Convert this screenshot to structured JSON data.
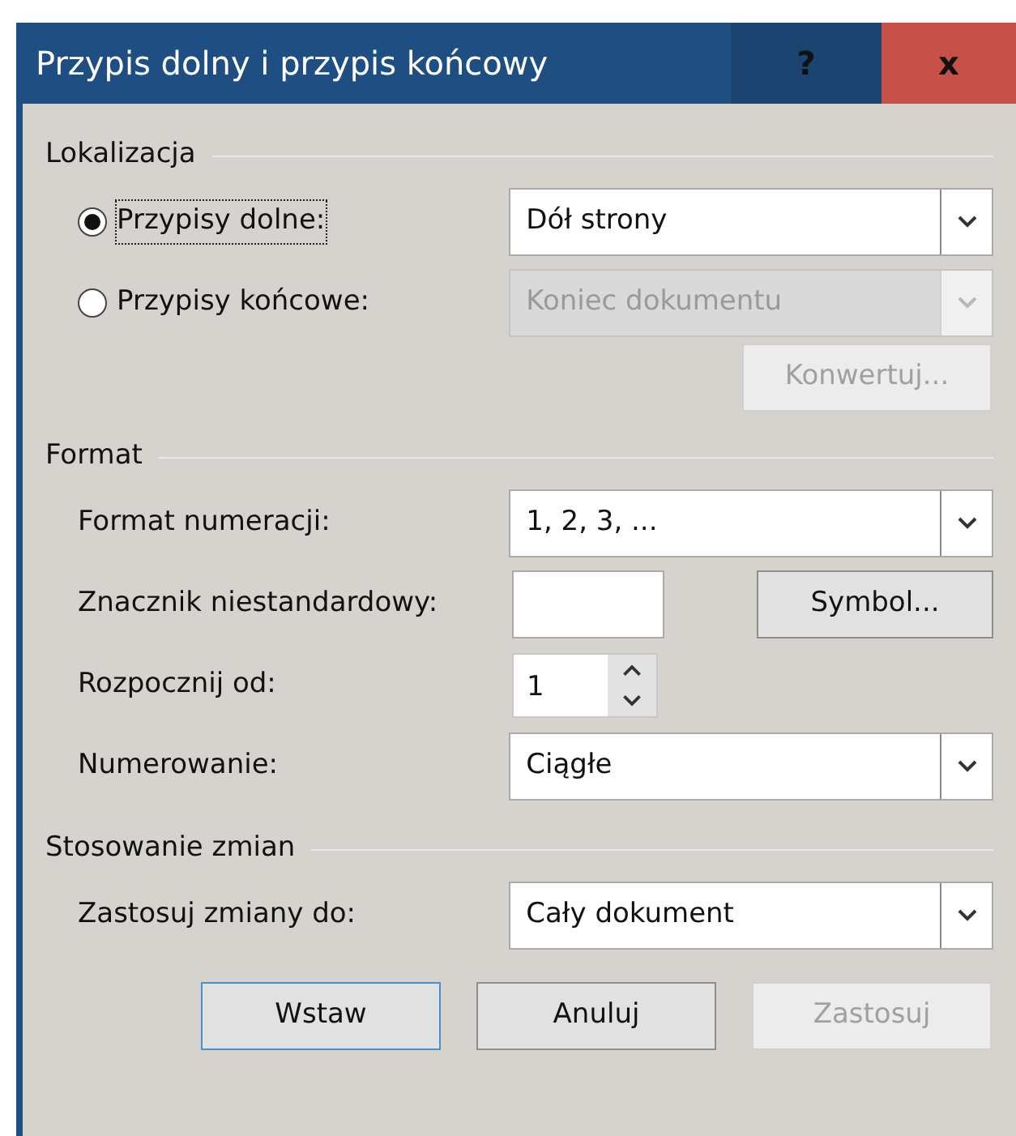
{
  "window": {
    "title": "Przypis dolny i przypis końcowy",
    "help_button": "?",
    "close_button": "x"
  },
  "sections": [
    {
      "title": "Lokalizacja",
      "rows": [
        {
          "kind": "radio",
          "label": "Przypisy dolne:",
          "selected": true,
          "focused": true,
          "control": {
            "kind": "dropdown",
            "value": "Dół strony",
            "disabled": false
          }
        },
        {
          "kind": "radio",
          "label": "Przypisy końcowe:",
          "selected": false,
          "focused": false,
          "control": {
            "kind": "dropdown",
            "value": "Koniec dokumentu",
            "disabled": true
          }
        },
        {
          "kind": "button",
          "button": {
            "label": "Konwertuj...",
            "disabled": true
          }
        }
      ]
    },
    {
      "title": "Format",
      "rows": [
        {
          "kind": "field",
          "label": "Format numeracji:",
          "control": {
            "kind": "dropdown",
            "value": "1, 2, 3, ...",
            "disabled": false
          }
        },
        {
          "kind": "field",
          "label": "Znacznik niestandardowy:",
          "control": {
            "kind": "text"
          },
          "button": {
            "label": "Symbol...",
            "disabled": false
          }
        },
        {
          "kind": "field",
          "label": "Rozpocznij od:",
          "control": {
            "kind": "spinner",
            "value": "1"
          }
        },
        {
          "kind": "field",
          "label": "Numerowanie:",
          "control": {
            "kind": "dropdown",
            "value": "Ciągłe",
            "disabled": false
          }
        }
      ]
    },
    {
      "title": "Stosowanie zmian",
      "rows": [
        {
          "kind": "field",
          "label": "Zastosuj zmiany do:",
          "control": {
            "kind": "dropdown",
            "value": "Cały dokument",
            "disabled": false
          }
        }
      ]
    }
  ],
  "buttons": [
    {
      "label": "Wstaw",
      "default": true,
      "disabled": false
    },
    {
      "label": "Anuluj",
      "default": false,
      "disabled": false
    },
    {
      "label": "Zastosuj",
      "default": false,
      "disabled": true
    }
  ]
}
